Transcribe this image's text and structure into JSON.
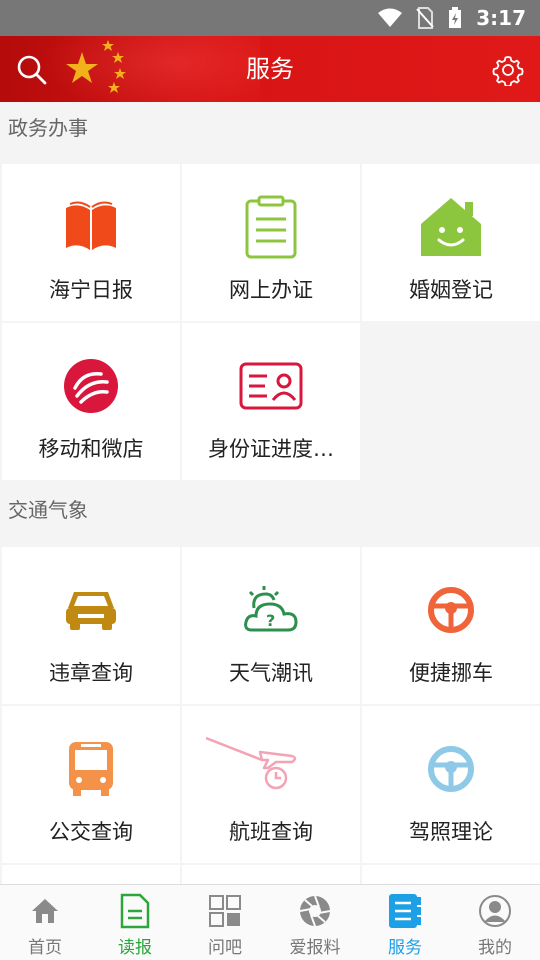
{
  "status_bar": {
    "time": "3:17"
  },
  "header": {
    "title": "服务"
  },
  "sections": [
    {
      "title": "政务办事",
      "items": [
        {
          "label": "海宁日报",
          "icon": "open-book-icon"
        },
        {
          "label": "网上办证",
          "icon": "clipboard-icon"
        },
        {
          "label": "婚姻登记",
          "icon": "smiling-house-icon"
        },
        {
          "label": "移动和微店",
          "icon": "china-mobile-logo-icon"
        },
        {
          "label": "身份证进度…",
          "icon": "id-card-icon"
        }
      ]
    },
    {
      "title": "交通气象",
      "items": [
        {
          "label": "违章查询",
          "icon": "car-icon"
        },
        {
          "label": "天气潮讯",
          "icon": "weather-cloud-icon"
        },
        {
          "label": "便捷挪车",
          "icon": "steering-wheel-icon"
        },
        {
          "label": "公交查询",
          "icon": "bus-icon"
        },
        {
          "label": "航班查询",
          "icon": "airplane-clock-icon"
        },
        {
          "label": "驾照理论",
          "icon": "steering-wheel-icon"
        }
      ]
    }
  ],
  "tabbar": [
    {
      "label": "首页",
      "icon": "home-icon"
    },
    {
      "label": "读报",
      "icon": "newspaper-icon"
    },
    {
      "label": "问吧",
      "icon": "grid-icon"
    },
    {
      "label": "爱报料",
      "icon": "camera-aperture-icon"
    },
    {
      "label": "服务",
      "icon": "list-book-icon",
      "active": true
    },
    {
      "label": "我的",
      "icon": "user-icon"
    }
  ],
  "colors": {
    "header_red": "#d81414",
    "active_tab": "#1ea0e6",
    "read_tab": "#2aa63a"
  }
}
